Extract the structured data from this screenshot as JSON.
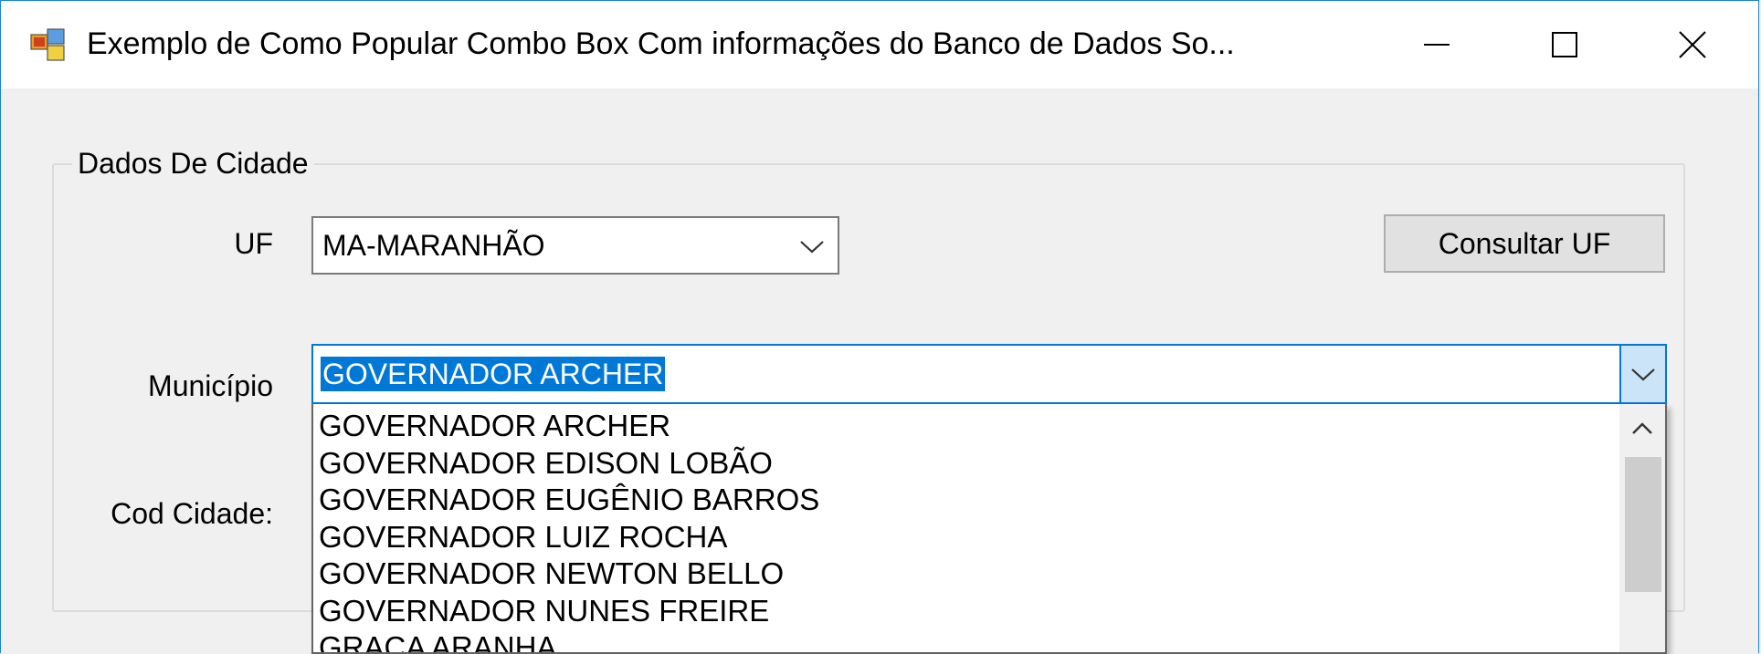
{
  "window": {
    "title": "Exemplo de Como Popular Combo Box Com informações do Banco de Dados So...",
    "minimize_label": "",
    "maximize_label": "",
    "close_label": ""
  },
  "group": {
    "title": "Dados De Cidade",
    "uf_label": "UF",
    "municipio_label": "Município",
    "cod_cidade_label": "Cod Cidade:"
  },
  "uf_combo": {
    "value": "MA-MARANHÃO"
  },
  "consultar_button": {
    "label": "Consultar UF"
  },
  "municipio_combo": {
    "value": "GOVERNADOR ARCHER"
  },
  "dropdown": {
    "items": [
      "GOVERNADOR ARCHER",
      "GOVERNADOR EDISON LOBÃO",
      "GOVERNADOR EUGÊNIO BARROS",
      "GOVERNADOR LUIZ ROCHA",
      "GOVERNADOR NEWTON BELLO",
      "GOVERNADOR NUNES FREIRE",
      "GRAÇA ARANHA"
    ]
  },
  "colors": {
    "selection": "#0078d7",
    "window_bg": "#f0f0f0",
    "border_focus": "#0078d7"
  }
}
